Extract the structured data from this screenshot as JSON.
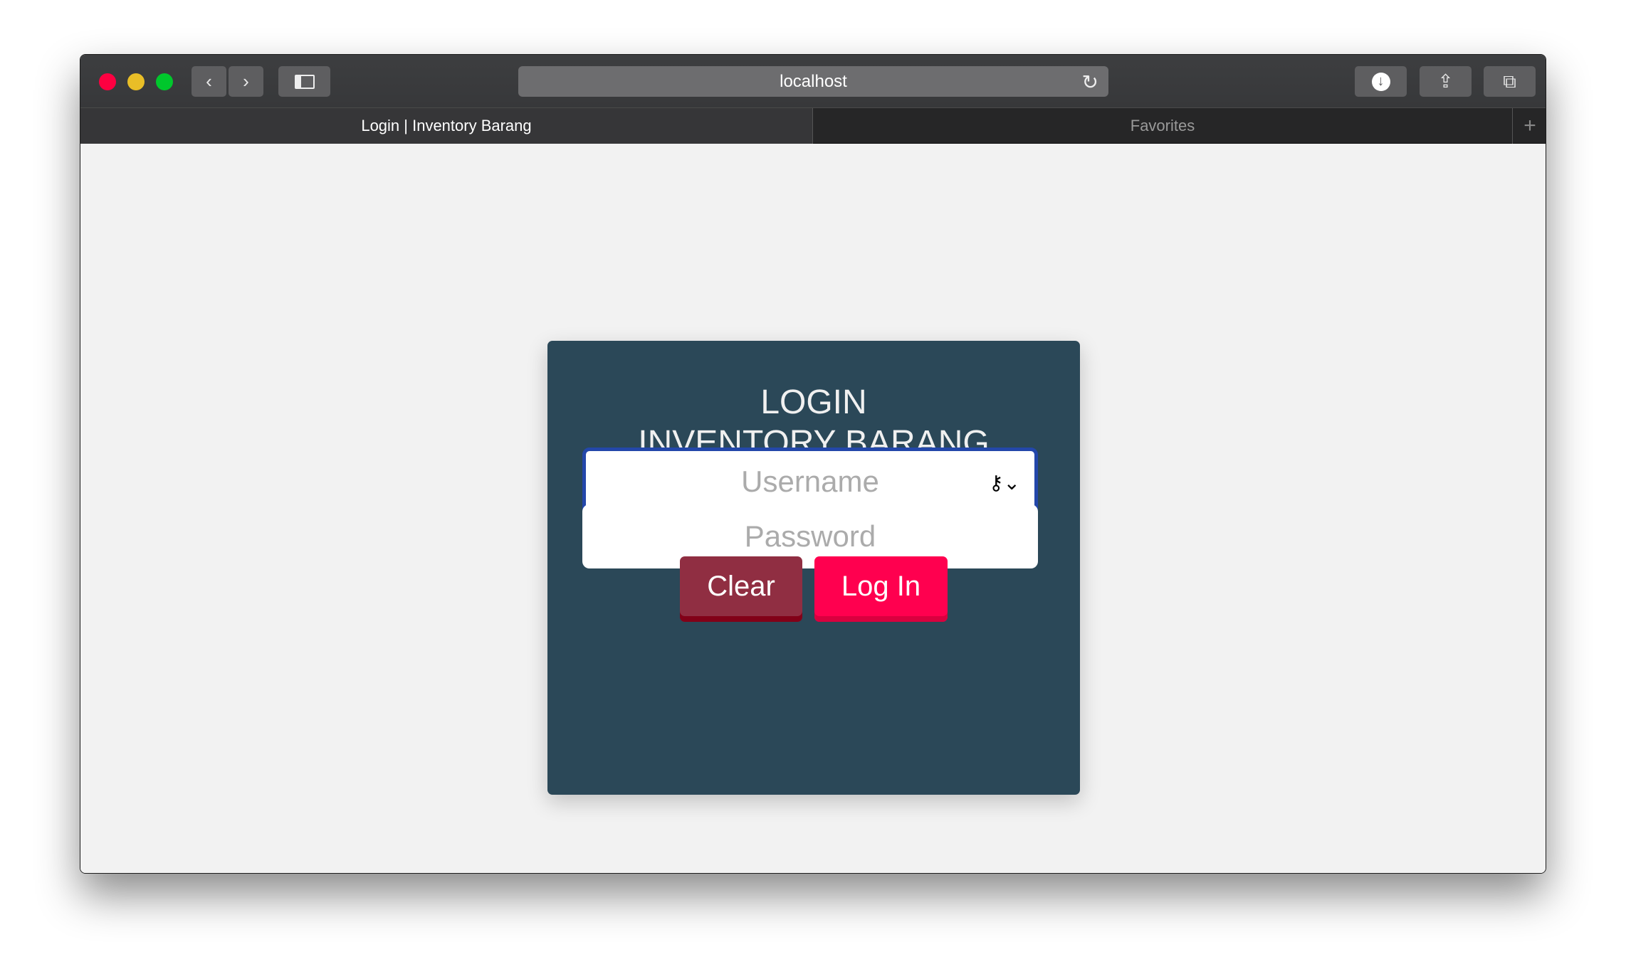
{
  "browser": {
    "url": "localhost",
    "tabs": [
      {
        "label": "Login | Inventory Barang",
        "active": true
      },
      {
        "label": "Favorites",
        "active": false
      }
    ],
    "new_tab": "+",
    "icons": {
      "back": "chevron-left-icon",
      "forward": "chevron-right-icon",
      "sidebar": "sidebar-icon",
      "reload": "reload-icon",
      "download": "download-icon",
      "share": "share-icon",
      "tabs": "tabs-icon"
    }
  },
  "login": {
    "title_line1": "LOGIN",
    "title_line2": "INVENTORY BARANG",
    "username_placeholder": "Username",
    "password_placeholder": "Password",
    "clear_label": "Clear",
    "login_label": "Log In"
  },
  "colors": {
    "card": "#2b4858",
    "clear": "#902e42",
    "login": "#ff004f",
    "focus": "#2347aa"
  }
}
